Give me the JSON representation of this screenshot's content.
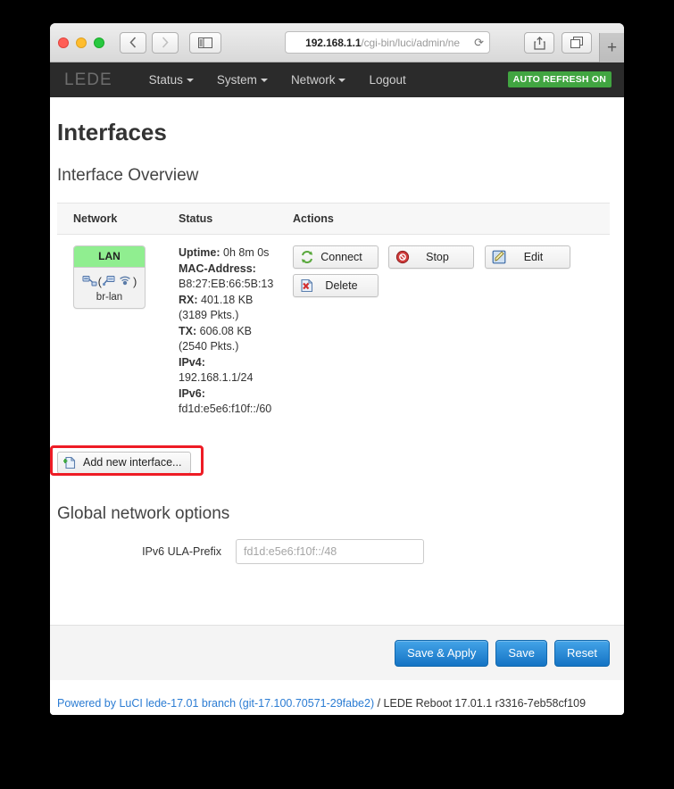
{
  "browser": {
    "url_bold": "192.168.1.1",
    "url_rest": "/cgi-bin/luci/admin/ne",
    "reload_icon": "reload-icon",
    "back_icon": "chevron-left-icon",
    "forward_icon": "chevron-right-icon",
    "sidebar_icon": "sidebar-toggle-icon",
    "share_icon": "share-icon",
    "tabs_icon": "show-tabs-icon",
    "newtab_label": "+"
  },
  "navbar": {
    "logo": "LEDE",
    "items": [
      {
        "label": "Status",
        "has_caret": true
      },
      {
        "label": "System",
        "has_caret": true
      },
      {
        "label": "Network",
        "has_caret": true
      },
      {
        "label": "Logout",
        "has_caret": false
      }
    ],
    "refresh_badge": "AUTO REFRESH ON",
    "refresh_badge_color": "#41a541"
  },
  "page": {
    "title": "Interfaces",
    "section_title": "Interface Overview",
    "global_title": "Global network options"
  },
  "table": {
    "headers": [
      "Network",
      "Status",
      "Actions"
    ],
    "rows": [
      {
        "network": {
          "name": "LAN",
          "name_bg": "#90ee90",
          "device": "br-lan",
          "icons": [
            "ethernet-icon",
            "ethernet-wifi-icon",
            "wifi-icon"
          ]
        },
        "status": [
          {
            "label": "Uptime:",
            "value": " 0h 8m 0s"
          },
          {
            "label": "MAC-Address:",
            "value": ""
          },
          {
            "label": "",
            "value": "B8:27:EB:66:5B:13"
          },
          {
            "label": "RX:",
            "value": " 401.18 KB"
          },
          {
            "label": "",
            "value": "(3189 Pkts.)"
          },
          {
            "label": "TX:",
            "value": " 606.08 KB"
          },
          {
            "label": "",
            "value": "(2540 Pkts.)"
          },
          {
            "label": "IPv4:",
            "value": ""
          },
          {
            "label": "",
            "value": "192.168.1.1/24"
          },
          {
            "label": "IPv6:",
            "value": ""
          },
          {
            "label": "",
            "value": "fd1d:e5e6:f10f::/60"
          }
        ],
        "actions": [
          {
            "label": "Connect",
            "icon": "connect-icon"
          },
          {
            "label": "Stop",
            "icon": "stop-icon"
          },
          {
            "label": "Edit",
            "icon": "edit-icon"
          },
          {
            "label": "Delete",
            "icon": "delete-icon"
          }
        ]
      }
    ]
  },
  "add_interface": {
    "label": "Add new interface...",
    "icon": "new-page-icon",
    "highlight_color": "#ee1c25"
  },
  "form": {
    "label": "IPv6 ULA-Prefix",
    "value": "",
    "placeholder": "fd1d:e5e6:f10f::/48"
  },
  "actionbar": {
    "buttons": [
      "Save & Apply",
      "Save",
      "Reset"
    ],
    "accent_color": "#1473c4"
  },
  "footer": {
    "link_text": "Powered by LuCI lede-17.01 branch (git-17.100.70571-29fabe2)",
    "tail_text": " / LEDE Reboot 17.01.1 r3316-7eb58cf109"
  }
}
